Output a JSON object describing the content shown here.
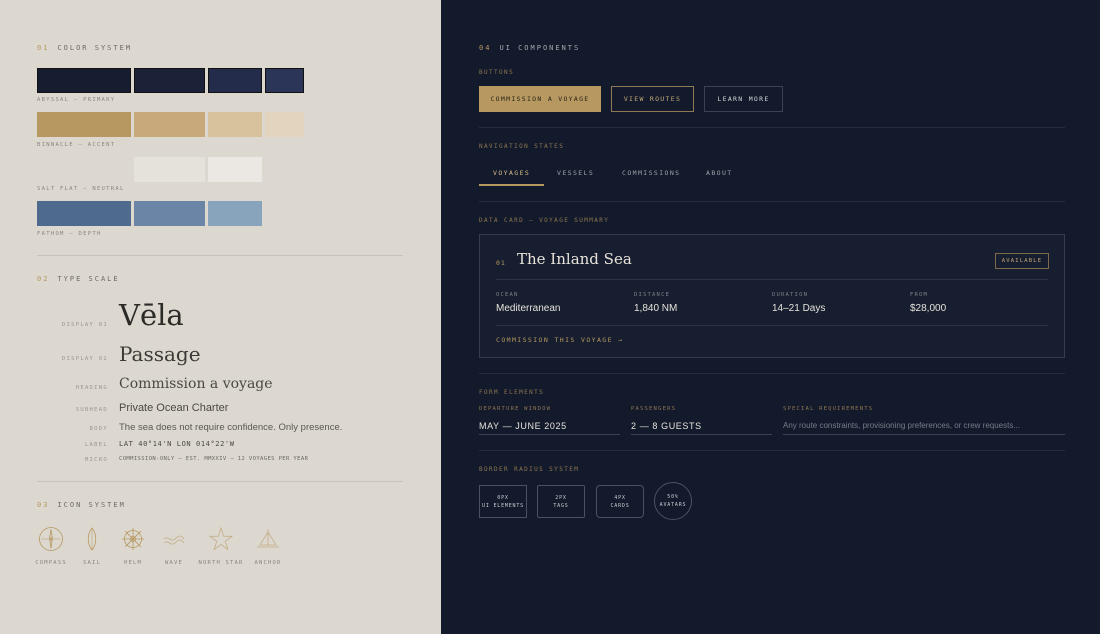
{
  "color_system": {
    "num": "01",
    "title": "COLOR SYSTEM",
    "rows": [
      {
        "label": "ABYSSAL — PRIMARY",
        "swatches": [
          "#171d30",
          "#1b2237",
          "#242c4b",
          "#2b3558"
        ]
      },
      {
        "label": "BINNACLE — ACCENT",
        "swatches": [
          "#b69860",
          "#c7a97c",
          "#d8c29e",
          "#e3d5bd"
        ]
      },
      {
        "label": "SALT FLAT — NEUTRAL",
        "swatches": [
          "#e5e2dc",
          "#ebe8e3"
        ]
      },
      {
        "label": "FATHOM — DEPTH",
        "swatches": [
          "#4e6a8d",
          "#6a85a6",
          "#88a4bd"
        ]
      }
    ]
  },
  "type_scale": {
    "num": "02",
    "title": "TYPE SCALE",
    "rows": [
      {
        "label": "DISPLAY 01",
        "sample": "Vēla"
      },
      {
        "label": "DISPLAY 02",
        "sample": "Passage"
      },
      {
        "label": "HEADING",
        "sample": "Commission a voyage"
      },
      {
        "label": "SUBHEAD",
        "sample": "Private Ocean Charter"
      },
      {
        "label": "BODY",
        "sample": "The sea does not require confidence. Only presence."
      },
      {
        "label": "LABEL",
        "sample": "LAT 40°14'N LON 014°22'W"
      },
      {
        "label": "MICRO",
        "sample": "COMMISSION-ONLY — EST. MMXXIV — 12 VOYAGES PER YEAR"
      }
    ]
  },
  "icon_system": {
    "num": "03",
    "title": "ICON SYSTEM",
    "icons": [
      {
        "name": "compass-icon",
        "label": "COMPASS"
      },
      {
        "name": "sail-icon",
        "label": "SAIL"
      },
      {
        "name": "helm-icon",
        "label": "HELM"
      },
      {
        "name": "wave-icon",
        "label": "WAVE"
      },
      {
        "name": "north-star-icon",
        "label": "NORTH STAR"
      },
      {
        "name": "anchor-icon",
        "label": "ANCHOR"
      }
    ]
  },
  "ui_components": {
    "num": "04",
    "title": "UI COMPONENTS",
    "buttons": {
      "heading": "BUTTONS",
      "primary": "COMMISSION A VOYAGE",
      "secondary": "VIEW ROUTES",
      "tertiary": "LEARN MORE"
    },
    "navigation": {
      "heading": "NAVIGATION STATES",
      "items": [
        "VOYAGES",
        "VESSELS",
        "COMMISSIONS",
        "ABOUT"
      ],
      "active_index": 0
    },
    "data_card": {
      "heading": "DATA CARD — VOYAGE SUMMARY",
      "num": "01",
      "title": "The Inland Sea",
      "badge": "AVAILABLE",
      "stats": [
        {
          "label": "OCEAN",
          "value": "Mediterranean"
        },
        {
          "label": "DISTANCE",
          "value": "1,840 NM"
        },
        {
          "label": "DURATION",
          "value": "14–21 Days"
        },
        {
          "label": "FROM",
          "value": "$28,000"
        }
      ],
      "link": "COMMISSION THIS VOYAGE →"
    },
    "form": {
      "heading": "FORM ELEMENTS",
      "departure": {
        "label": "DEPARTURE WINDOW",
        "value": "MAY — JUNE 2025"
      },
      "passengers": {
        "label": "PASSENGERS",
        "value": "2 — 8 GUESTS"
      },
      "requirements": {
        "label": "SPECIAL REQUIREMENTS",
        "placeholder": "Any route constraints, provisioning preferences, or crew requests..."
      }
    },
    "border_radius": {
      "heading": "BORDER RADIUS SYSTEM",
      "items": [
        {
          "value": "0px",
          "label": "UI ELEMENTS"
        },
        {
          "value": "2px",
          "label": "TAGS"
        },
        {
          "value": "4px",
          "label": "CARDS"
        },
        {
          "value": "50%",
          "label": "AVATARS"
        }
      ]
    }
  },
  "colors": {
    "accent": "#b69860",
    "navy": "#131a2b",
    "salt": "#dcd8d0"
  }
}
